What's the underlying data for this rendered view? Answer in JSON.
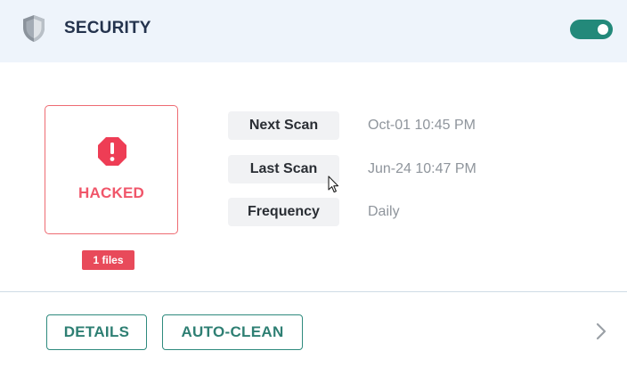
{
  "header": {
    "title": "SECURITY",
    "icon": "shield-icon",
    "toggle_on": true,
    "toggle_color": "#23897a"
  },
  "status": {
    "label": "HACKED",
    "icon": "alert-octagon-icon",
    "color": "#f0566a",
    "files_badge": "1 files"
  },
  "info": [
    {
      "label": "Next Scan",
      "value": "Oct-01 10:45 PM"
    },
    {
      "label": "Last Scan",
      "value": "Jun-24 10:47 PM"
    },
    {
      "label": "Frequency",
      "value": "Daily"
    }
  ],
  "footer": {
    "details_label": "DETAILS",
    "autoclean_label": "AUTO-CLEAN",
    "more_icon": "chevron-right-icon",
    "accent_color": "#2e8a7d"
  }
}
